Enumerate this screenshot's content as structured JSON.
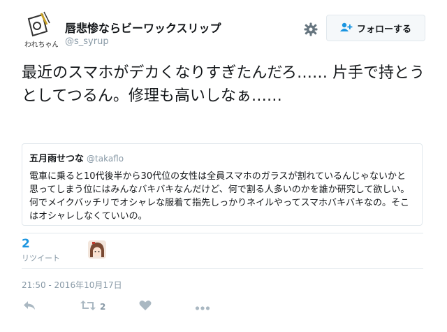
{
  "tweet": {
    "author_name": "唇悲惨ならビーワックスリップ",
    "author_handle": "@s_syrup",
    "avatar_text": "われちゃん",
    "follow_label": "フォローする",
    "text": "最近のスマホがデカくなりすぎたんだろ…… 片手で持とうとしてつるん。修理も高いしなぁ……",
    "quoted": {
      "name": "五月雨せつな",
      "handle": "@takaflo",
      "text": "電車に乗ると10代後半から30代位の女性は全員スマホのガラスが割れているんじゃないかと思ってしまう位にはみんなバキバキなんだけど、何で割る人多いのかを誰か研究して欲しい。何でメイクバッチリでオシャレな服着て指先しっかりネイルやってスマホバキバキなの。そこはオシャレしなくていいの。"
    },
    "retweet_count": "2",
    "retweet_label": "リツイート",
    "timestamp": "21:50 - 2016年10月17日",
    "actions": {
      "reply_icon": "reply-icon",
      "retweet_icon": "retweet-icon",
      "retweet_count": "2",
      "like_icon": "heart-icon",
      "more_icon": "more-icon"
    }
  },
  "colors": {
    "accent": "#1b95e0",
    "muted": "#8899a6",
    "border": "#e1e8ed",
    "icon": "#aab8c2"
  }
}
